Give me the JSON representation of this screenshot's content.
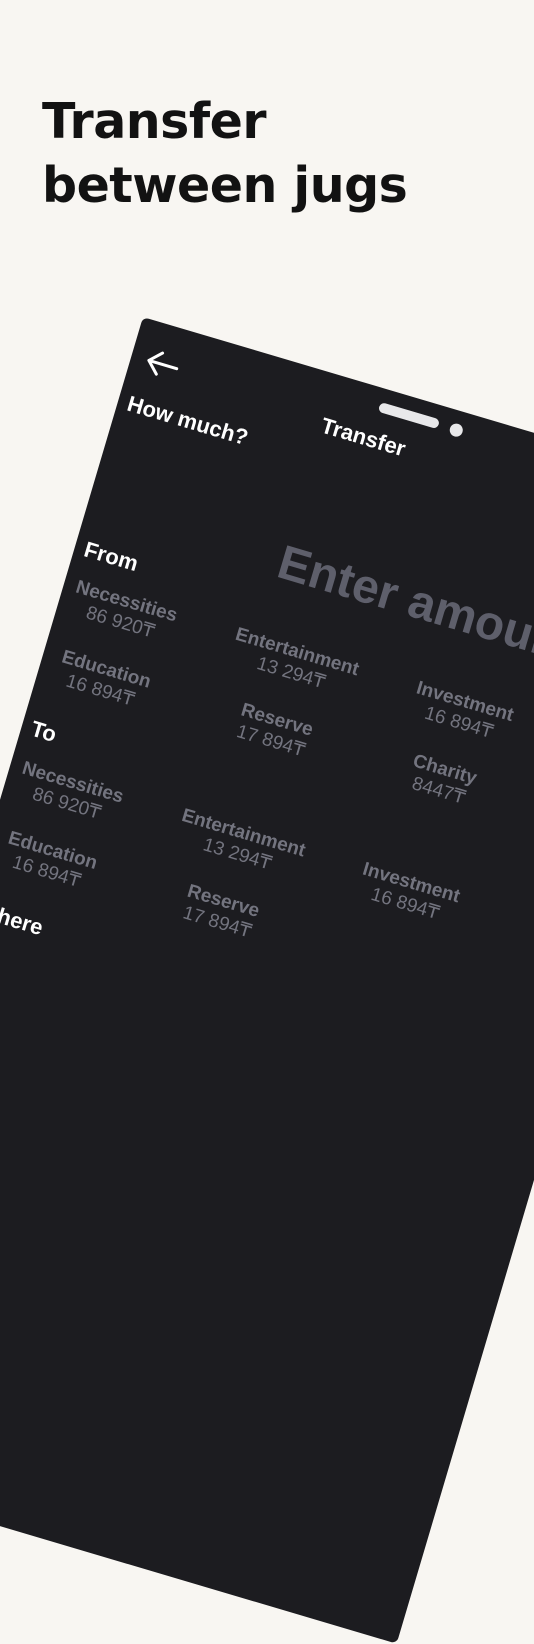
{
  "headline": "Transfer between jugs",
  "screen": {
    "title": "Transfer",
    "how_much_label": "How much?",
    "amount_placeholder": "Enter amount",
    "from_label": "From",
    "to_label": "To",
    "where_label": "Where"
  },
  "from_jugs": [
    {
      "name": "Necessities",
      "amount": "86 920₸"
    },
    {
      "name": "Entertainment",
      "amount": "13 294₸"
    },
    {
      "name": "Investment",
      "amount": "16 894₸"
    },
    {
      "name": "Education",
      "amount": "16 894₸"
    },
    {
      "name": "Reserve",
      "amount": "17 894₸"
    },
    {
      "name": "Charity",
      "amount": "8447₸"
    }
  ],
  "to_jugs": [
    {
      "name": "Necessities",
      "amount": "86 920₸"
    },
    {
      "name": "Entertainment",
      "amount": "13 294₸"
    },
    {
      "name": "Investment",
      "amount": "16 894₸"
    },
    {
      "name": "Education",
      "amount": "16 894₸"
    },
    {
      "name": "Reserve",
      "amount": "17 894₸"
    }
  ],
  "colors": {
    "background": "#f8f6f2",
    "phone_screen": "#1c1c20",
    "muted_text": "#73747f",
    "placeholder_text": "#5e5f6b"
  },
  "icons": {
    "back": "arrow-left-icon"
  }
}
